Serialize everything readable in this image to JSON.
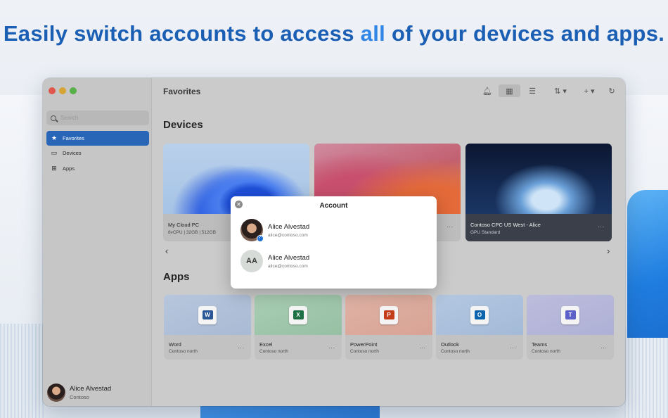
{
  "headline": {
    "part1": "Easily switch accounts to access ",
    "accent": "all",
    "part2": " of your devices and apps."
  },
  "window": {
    "title": "Favorites"
  },
  "sidebar": {
    "search_placeholder": "Search",
    "items": [
      {
        "label": "Favorites",
        "icon": "star-icon",
        "active": true
      },
      {
        "label": "Devices",
        "icon": "monitor-icon",
        "active": false
      },
      {
        "label": "Apps",
        "icon": "apps-grid-icon",
        "active": false
      }
    ],
    "profile": {
      "name": "Alice Alvestad",
      "org": "Contoso"
    }
  },
  "main": {
    "devices_heading": "Devices",
    "apps_heading": "Apps",
    "devices": [
      {
        "name": "My Cloud PC",
        "spec": "8vCPU | 32GB | 512GB",
        "more": "..."
      },
      {
        "name": "",
        "spec": "",
        "more": "..."
      },
      {
        "name": "Contoso CPC US West - Alice",
        "spec": "GPU Standard",
        "more": "..."
      }
    ],
    "apps": [
      {
        "name": "Word",
        "org": "Contoso north",
        "letter": "W",
        "color": "#2b5797",
        "more": "..."
      },
      {
        "name": "Excel",
        "org": "Contoso north",
        "letter": "X",
        "color": "#1e7145",
        "more": "..."
      },
      {
        "name": "PowerPoint",
        "org": "Contoso north",
        "letter": "P",
        "color": "#c43e1c",
        "more": "..."
      },
      {
        "name": "Outlook",
        "org": "Contoso north",
        "letter": "O",
        "color": "#0a64ad",
        "more": "..."
      },
      {
        "name": "Teams",
        "org": "Contoso north",
        "letter": "T",
        "color": "#5b5fc7",
        "more": "..."
      }
    ]
  },
  "dialog": {
    "title": "Account",
    "accounts": [
      {
        "name": "Alice Alvestad",
        "email": "alice@contoso.com",
        "initials": ""
      },
      {
        "name": "Alice Alvestad",
        "email": "alice@contoso.com",
        "initials": "AA"
      }
    ]
  },
  "colors": {
    "accent": "#2a66b8",
    "headline": "#1a5fb4"
  }
}
